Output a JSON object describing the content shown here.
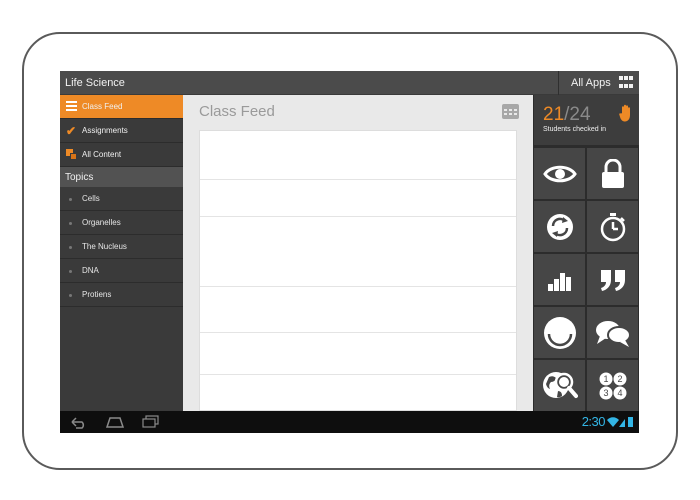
{
  "app": {
    "title": "Life Science",
    "all_apps_label": "All Apps"
  },
  "sidebar": {
    "items": [
      {
        "label": "Class Feed",
        "icon": "menu-icon",
        "active": true
      },
      {
        "label": "Assignments",
        "icon": "checkmark-icon"
      },
      {
        "label": "All Content",
        "icon": "stack-icon"
      }
    ],
    "topics_header": "Topics",
    "topics": [
      "Cells",
      "Organelles",
      "The Nucleus",
      "DNA",
      "Protiens"
    ]
  },
  "main": {
    "title": "Class Feed"
  },
  "checkin": {
    "done": "21",
    "separator": "/",
    "total": "24",
    "label": "Students checked in"
  },
  "tools": [
    {
      "icon": "eye-icon"
    },
    {
      "icon": "lock-icon"
    },
    {
      "icon": "refresh-icon"
    },
    {
      "icon": "stopwatch-icon"
    },
    {
      "icon": "bar-chart-icon"
    },
    {
      "icon": "quote-icon"
    },
    {
      "icon": "smiley-icon"
    },
    {
      "icon": "chat-bubbles-icon"
    },
    {
      "icon": "globe-search-icon"
    },
    {
      "icon": "numbers-icon"
    }
  ],
  "system": {
    "time": "2:30"
  },
  "colors": {
    "accent": "#ee8a26",
    "status_blue": "#33b5e5",
    "dark": "#2f2f2f"
  }
}
